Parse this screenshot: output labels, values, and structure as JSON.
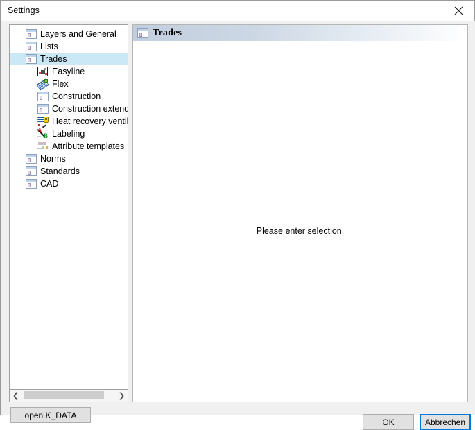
{
  "window": {
    "title": "Settings",
    "close_icon": "close-icon"
  },
  "tree": {
    "items": [
      {
        "label": "Layers and General",
        "icon": "window-list-icon",
        "level": 0,
        "selected": false
      },
      {
        "label": "Lists",
        "icon": "window-list-icon",
        "level": 0,
        "selected": false
      },
      {
        "label": "Trades",
        "icon": "window-list-icon",
        "level": 0,
        "selected": true
      },
      {
        "label": "Easyline",
        "icon": "easyline-icon",
        "level": 1,
        "selected": false
      },
      {
        "label": "Flex",
        "icon": "flex-icon",
        "level": 1,
        "selected": false
      },
      {
        "label": "Construction",
        "icon": "window-list-icon",
        "level": 1,
        "selected": false
      },
      {
        "label": "Construction extended",
        "icon": "window-list-icon",
        "level": 1,
        "selected": false
      },
      {
        "label": "Heat recovery ventilation",
        "icon": "heat-recovery-icon",
        "level": 1,
        "selected": false
      },
      {
        "label": "Labeling",
        "icon": "labeling-icon",
        "level": 1,
        "selected": false
      },
      {
        "label": "Attribute templates",
        "icon": "attribute-templates-icon",
        "level": 1,
        "selected": false
      },
      {
        "label": "Norms",
        "icon": "window-list-icon",
        "level": 0,
        "selected": false
      },
      {
        "label": "Standards",
        "icon": "window-list-icon",
        "level": 0,
        "selected": false
      },
      {
        "label": "CAD",
        "icon": "window-list-icon",
        "level": 0,
        "selected": false
      }
    ],
    "scrollbar": {
      "left_arrow": "❮",
      "right_arrow": "❯"
    }
  },
  "left_actions": {
    "open_kdata_label": "open K_DATA"
  },
  "right_panel": {
    "header_title": "Trades",
    "header_icon": "window-list-icon",
    "placeholder": "Please enter selection."
  },
  "footer": {
    "ok_label": "OK",
    "cancel_label": "Abbrechen"
  },
  "colors": {
    "selection": "#cbe8f6",
    "focus_border": "#0078d7",
    "dialog_background": "#f0f0f0",
    "header_gradient_start": "#c2cede",
    "header_gradient_end": "#ffffff"
  }
}
